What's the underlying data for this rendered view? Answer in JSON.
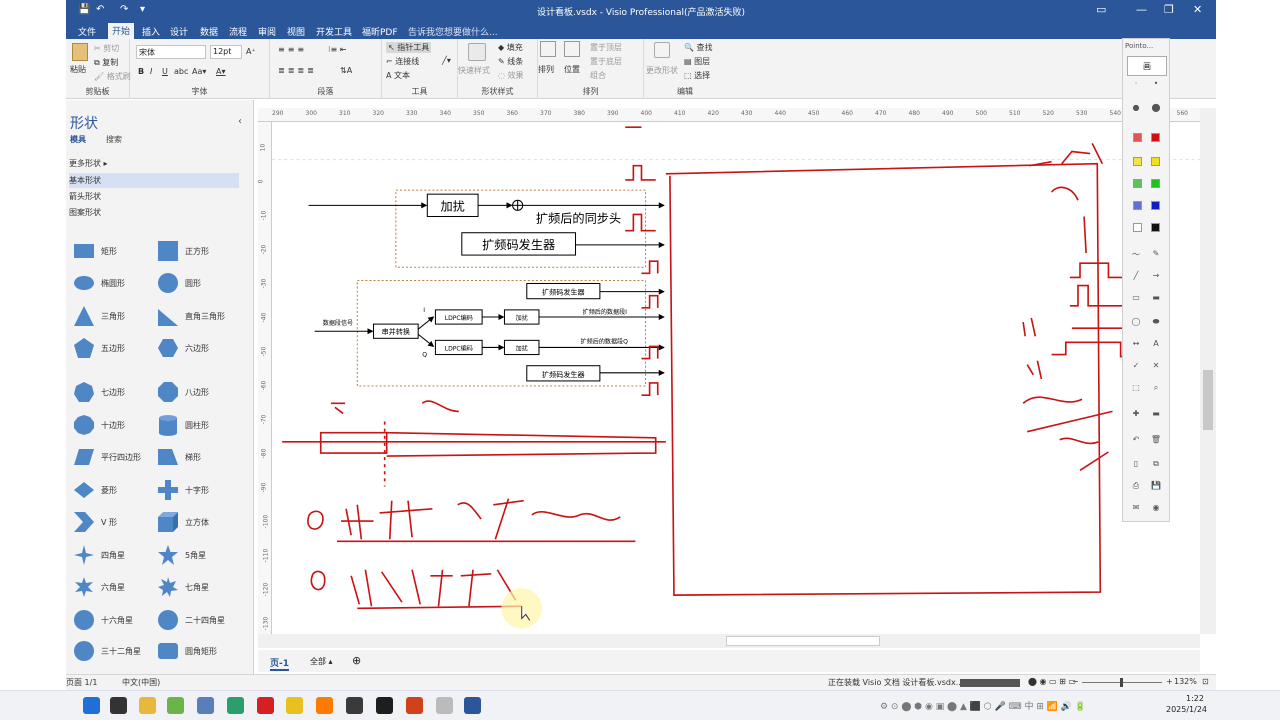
{
  "window": {
    "title": "设计看板.vsdx - Visio Professional(产品激活失败)",
    "controls": [
      "—",
      "❐",
      "✕"
    ]
  },
  "tabs": [
    {
      "label": "文件"
    },
    {
      "label": "开始"
    },
    {
      "label": "插入"
    },
    {
      "label": "设计"
    },
    {
      "label": "数据"
    },
    {
      "label": "流程"
    },
    {
      "label": "审阅"
    },
    {
      "label": "视图"
    },
    {
      "label": "开发工具"
    },
    {
      "label": "福昕PDF"
    }
  ],
  "tell_me": "告诉我您想要做什么...",
  "ribbon": {
    "clipboard": {
      "label": "剪贴板",
      "paste": "粘贴",
      "cut": "剪切",
      "copy": "复制",
      "format_painter": "格式刷"
    },
    "font": {
      "label": "字体",
      "family": "宋体",
      "size": "12pt"
    },
    "paragraph": {
      "label": "段落"
    },
    "tools": {
      "label": "工具",
      "pointer": "指针工具",
      "connector": "连接线",
      "text": "A 文本"
    },
    "shape_styles": {
      "label": "形状样式",
      "quick_styles": "快速样式",
      "fill": "填充",
      "line": "线条",
      "effects": "效果"
    },
    "arrange": {
      "label": "排列",
      "arrange": "排列",
      "position": "位置",
      "bring_front": "置于顶层",
      "send_back": "置于底层",
      "group": "组合"
    },
    "editing": {
      "label": "编辑",
      "change_shape": "更改形状",
      "find": "查找",
      "layers": "图层",
      "select": "选择"
    }
  },
  "shapes_panel": {
    "title": "形状",
    "tab_stencils": "模具",
    "tab_search": "搜索",
    "stencils": [
      "更多形状",
      "基本形状",
      "箭头形状",
      "图案形状"
    ],
    "shapes": [
      {
        "label": "矩形",
        "icon": "rectangle-icon"
      },
      {
        "label": "正方形",
        "icon": "square-icon"
      },
      {
        "label": "椭圆形",
        "icon": "ellipse-icon"
      },
      {
        "label": "圆形",
        "icon": "circle-icon"
      },
      {
        "label": "三角形",
        "icon": "triangle-icon"
      },
      {
        "label": "直角三角形",
        "icon": "right-triangle-icon"
      },
      {
        "label": "五边形",
        "icon": "pentagon-icon"
      },
      {
        "label": "六边形",
        "icon": "hexagon-icon"
      },
      {
        "label": "七边形",
        "icon": "heptagon-icon"
      },
      {
        "label": "八边形",
        "icon": "octagon-icon"
      },
      {
        "label": "十边形",
        "icon": "decagon-icon"
      },
      {
        "label": "圆柱形",
        "icon": "cylinder-icon"
      },
      {
        "label": "平行四边形",
        "icon": "parallelogram-icon"
      },
      {
        "label": "梯形",
        "icon": "trapezoid-icon"
      },
      {
        "label": "菱形",
        "icon": "diamond-icon"
      },
      {
        "label": "十字形",
        "icon": "cross-icon"
      },
      {
        "label": "V 形",
        "icon": "chevron-icon"
      },
      {
        "label": "立方体",
        "icon": "cube-icon"
      },
      {
        "label": "四角星",
        "icon": "star4-icon"
      },
      {
        "label": "5角星",
        "icon": "star5-icon"
      },
      {
        "label": "六角星",
        "icon": "star6-icon"
      },
      {
        "label": "七角星",
        "icon": "star7-icon"
      },
      {
        "label": "十六角星",
        "icon": "star16-icon"
      },
      {
        "label": "二十四角星",
        "icon": "star24-icon"
      },
      {
        "label": "三十二角星",
        "icon": "star32-icon"
      },
      {
        "label": "圆角矩形",
        "icon": "rounded-rect-icon"
      }
    ]
  },
  "ruler": {
    "h_ticks": [
      "290",
      "300",
      "310",
      "320",
      "330",
      "340",
      "350",
      "360",
      "370",
      "380",
      "390",
      "400",
      "410",
      "420",
      "430",
      "440",
      "450",
      "460",
      "470",
      "480",
      "490",
      "500",
      "510",
      "520",
      "530",
      "540",
      "550",
      "560"
    ],
    "v_ticks": [
      "10",
      "0",
      "-10",
      "-20",
      "-30",
      "-40",
      "-50",
      "-60",
      "-70",
      "-80",
      "-90",
      "-100",
      "-110",
      "-120",
      "-130"
    ]
  },
  "diagram": {
    "top_block": {
      "jiarao": "加扰",
      "sync_label": "扩频后的同步头",
      "spread_gen": "扩频码发生器"
    },
    "bottom_block": {
      "spread_gen_top": "扩频码发生器",
      "input_label": "数据段信号",
      "sp_convert": "串并转换",
      "i_label": "I",
      "q_label": "Q",
      "ldpc1": "LDPC编码",
      "ldpc2": "LDPC编码",
      "jiarao1": "加扰",
      "jiarao2": "加扰",
      "out_i": "扩频后的数据段I",
      "out_q": "扩频后的数据段Q",
      "spread_gen_bottom": "扩频码发生器"
    }
  },
  "page_bar": {
    "page": "页-1",
    "all": "全部",
    "add": "⊕"
  },
  "status": {
    "page": "页面 1/1",
    "lang": "中文(中国)",
    "loading": "正在装载 Visio 文档 设计看板.vsdx...",
    "zoom": "132%"
  },
  "taskbar": {
    "time": "1:22",
    "date": "2025/1/24"
  },
  "pointofix": {
    "title": "Pointo...",
    "mode": "画"
  }
}
